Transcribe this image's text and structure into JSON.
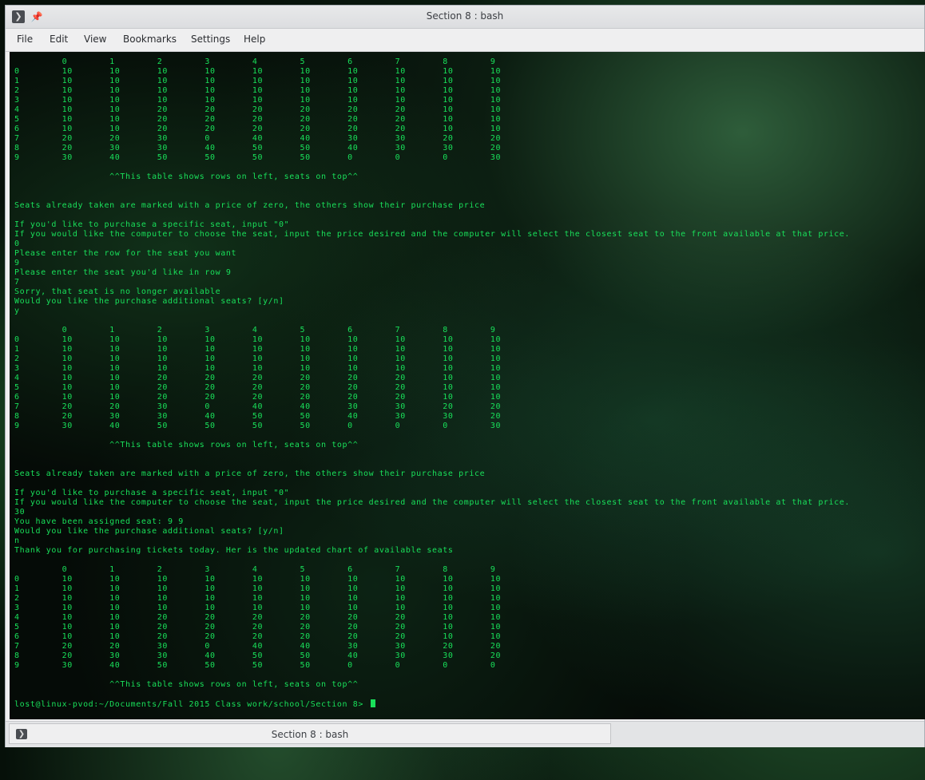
{
  "window": {
    "title": "Section 8 : bash",
    "terminal_icon": "terminal-icon",
    "pin_icon": "pin-icon"
  },
  "menu": {
    "file": "File",
    "edit": "Edit",
    "view": "View",
    "bookmarks": "Bookmarks",
    "settings": "Settings",
    "help": "Help"
  },
  "terminal": {
    "output": "         0        1        2        3        4        5        6        7        8        9\n0        10       10       10       10       10       10       10       10       10       10\n1        10       10       10       10       10       10       10       10       10       10\n2        10       10       10       10       10       10       10       10       10       10\n3        10       10       10       10       10       10       10       10       10       10\n4        10       10       20       20       20       20       20       20       10       10\n5        10       10       20       20       20       20       20       20       10       10\n6        10       10       20       20       20       20       20       20       10       10\n7        20       20       30       0        40       40       30       30       20       20\n8        20       30       30       40       50       50       40       30       30       20\n9        30       40       50       50       50       50       0        0        0        30\n\n                  ^^This table shows rows on left, seats on top^^\n\n\nSeats already taken are marked with a price of zero, the others show their purchase price\n\nIf you'd like to purchase a specific seat, input \"0\"\nIf you would like the computer to choose the seat, input the price desired and the computer will select the closest seat to the front available at that price.\n0\nPlease enter the row for the seat you want\n9\nPlease enter the seat you'd like in row 9\n7\nSorry, that seat is no longer available\nWould you like the purchase additional seats? [y/n]\ny\n\n         0        1        2        3        4        5        6        7        8        9\n0        10       10       10       10       10       10       10       10       10       10\n1        10       10       10       10       10       10       10       10       10       10\n2        10       10       10       10       10       10       10       10       10       10\n3        10       10       10       10       10       10       10       10       10       10\n4        10       10       20       20       20       20       20       20       10       10\n5        10       10       20       20       20       20       20       20       10       10\n6        10       10       20       20       20       20       20       20       10       10\n7        20       20       30       0        40       40       30       30       20       20\n8        20       30       30       40       50       50       40       30       30       20\n9        30       40       50       50       50       50       0        0        0        30\n\n                  ^^This table shows rows on left, seats on top^^\n\n\nSeats already taken are marked with a price of zero, the others show their purchase price\n\nIf you'd like to purchase a specific seat, input \"0\"\nIf you would like the computer to choose the seat, input the price desired and the computer will select the closest seat to the front available at that price.\n30\nYou have been assigned seat: 9 9\nWould you like the purchase additional seats? [y/n]\nn\nThank you for purchasing tickets today. Her is the updated chart of available seats\n\n         0        1        2        3        4        5        6        7        8        9\n0        10       10       10       10       10       10       10       10       10       10\n1        10       10       10       10       10       10       10       10       10       10\n2        10       10       10       10       10       10       10       10       10       10\n3        10       10       10       10       10       10       10       10       10       10\n4        10       10       20       20       20       20       20       20       10       10\n5        10       10       20       20       20       20       20       20       10       10\n6        10       10       20       20       20       20       20       20       10       10\n7        20       20       30       0        40       40       30       30       20       20\n8        20       30       30       40       50       50       40       30       30       20\n9        30       40       50       50       50       50       0        0        0        0\n\n                  ^^This table shows rows on left, seats on top^^\n\n",
    "prompt": "lost@linux-pvod:~/Documents/Fall 2015 Class work/school/Section 8> "
  },
  "tab": {
    "label": "Section 8 : bash"
  },
  "colors": {
    "terminal_text": "#19e05a",
    "titlebar": "#e3e4e6"
  }
}
